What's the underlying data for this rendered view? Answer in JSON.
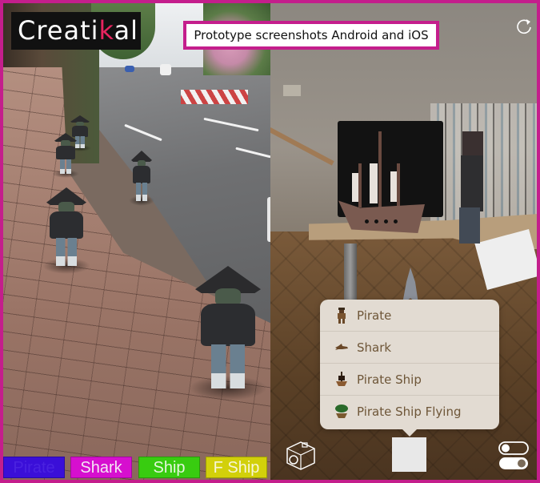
{
  "brand": {
    "logo_prefix": "Creati",
    "logo_highlight": "k",
    "logo_suffix": "al",
    "logo_bg": "#111111",
    "logo_highlight_color": "#e8245f",
    "frame_color": "#c41e8c"
  },
  "banner": {
    "title": "Prototype screenshots Android and iOS"
  },
  "android": {
    "scene": "street-sidewalk-with-ar-pirates",
    "buttons": [
      {
        "label": "Pirate",
        "bg": "#3a0fd8",
        "fg": "#4a22e0"
      },
      {
        "label": "Shark",
        "bg": "#d60fcf",
        "fg": "#f4e6f4"
      },
      {
        "label": "Ship",
        "bg": "#38cc10",
        "fg": "#e6f7de"
      },
      {
        "label": "F Ship",
        "bg": "#d2d00a",
        "fg": "#f8f6d6"
      }
    ]
  },
  "ios": {
    "scene": "office-desk-with-ar-ship-shark-figure",
    "top_icon": "refresh-icon",
    "menu": {
      "items": [
        {
          "label": "Pirate",
          "icon": "pirate-icon"
        },
        {
          "label": "Shark",
          "icon": "shark-icon"
        },
        {
          "label": "Pirate Ship",
          "icon": "pirate-ship-icon"
        },
        {
          "label": "Pirate Ship Flying",
          "icon": "pirate-ship-flying-icon"
        }
      ]
    },
    "bottom_bar": {
      "left_icon": "camera-icon",
      "center": "shutter-button",
      "right_icon": "toggles-icon"
    }
  }
}
